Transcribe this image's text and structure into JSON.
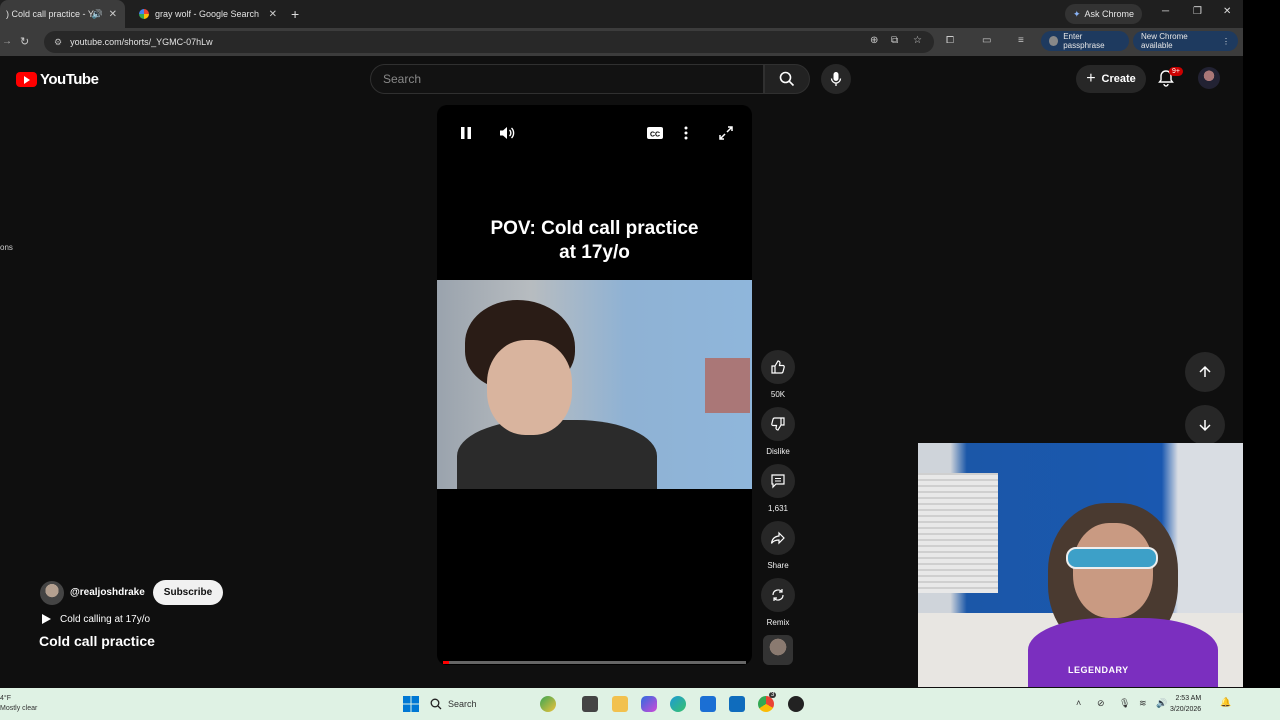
{
  "browser": {
    "tabs": [
      {
        "title": ") Cold call practice - You",
        "active": true
      },
      {
        "title": "gray wolf - Google Search",
        "active": false
      }
    ],
    "ask_chrome": "Ask Chrome",
    "url": "youtube.com/shorts/_YGMC-07hLw",
    "enter_passphrase": "Enter passphrase",
    "new_chrome": "New Chrome available"
  },
  "youtube": {
    "logo_text": "YouTube",
    "search_placeholder": "Search",
    "create_label": "Create",
    "notif_badge": "9+"
  },
  "left_fragment": "ons",
  "short": {
    "overlay_title_line1": "POV: Cold call practice",
    "overlay_title_line2": "at 17y/o",
    "channel": "@realjoshdrake",
    "subscribe": "Subscribe",
    "sound": "Cold calling at 17y/o",
    "title": "Cold call practice",
    "progress": 0.02
  },
  "actions": {
    "like_count": "50K",
    "dislike": "Dislike",
    "comments": "1,631",
    "share": "Share",
    "remix": "Remix"
  },
  "webcam": {
    "shirt_text": "LEGENDARY"
  },
  "taskbar": {
    "weather_temp": "4°F",
    "weather_desc": "Mostly clear",
    "search": "Search",
    "time": "2:53 AM",
    "date": "3/20/2026",
    "chrome_badge": "3"
  },
  "colors": {
    "youtube_red": "#ff0000",
    "taskbar_bg": "#dff2e4",
    "webcam_shirt": "#7b2fbf"
  }
}
